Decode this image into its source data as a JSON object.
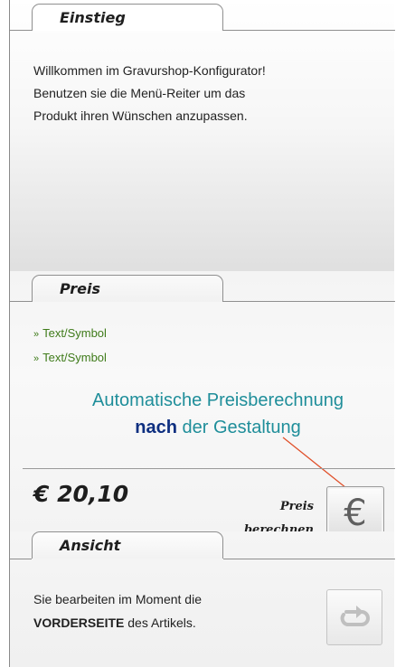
{
  "einstieg": {
    "tab_label": "Einstieg",
    "intro_lines": [
      "Willkommen im Gravurshop-Konfigurator!",
      "Benutzen sie die Menü-Reiter um das",
      "Produkt ihren Wünschen anzupassen."
    ]
  },
  "preis": {
    "tab_label": "Preis",
    "items": [
      {
        "bullet": "»",
        "label": "Text/Symbol"
      },
      {
        "bullet": "»",
        "label": "Text/Symbol"
      }
    ],
    "annotation_line1": "Automatische Preisberechnung",
    "annotation_strong": "nach",
    "annotation_rest": "der Gestaltung",
    "price": "€ 20,10",
    "calc_label_line1": "Preis",
    "calc_label_line2": "berechnen",
    "calc_icon": "euro-icon",
    "colors": {
      "link": "#3f7b1a",
      "annotation": "#1f8e9a",
      "annotation_strong": "#0e2f80",
      "pointer": "#e0502a"
    }
  },
  "ansicht": {
    "tab_label": "Ansicht",
    "text_part1": "Sie bearbeiten im Moment die",
    "text_strong": "VORDERSEITE",
    "text_part2": "des Artikels.",
    "rotate_icon": "rotate-icon"
  }
}
